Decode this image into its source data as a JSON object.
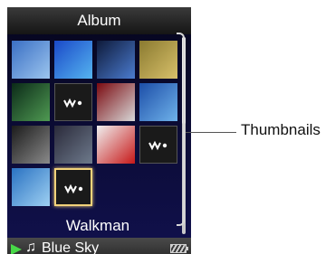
{
  "header": {
    "title": "Album"
  },
  "grid": {
    "thumbnails": [
      {
        "name": "album-art-snowman",
        "colors": [
          "#3a6fc4",
          "#9cc5ee"
        ]
      },
      {
        "name": "album-art-blue-burst",
        "colors": [
          "#1a49c8",
          "#55b4f0"
        ]
      },
      {
        "name": "album-art-microphone",
        "colors": [
          "#0e1a3a",
          "#4b7cd0"
        ]
      },
      {
        "name": "album-art-building",
        "colors": [
          "#8a7a30",
          "#d8c06a"
        ]
      },
      {
        "name": "album-art-green-plant",
        "colors": [
          "#0b2a18",
          "#4f9a52"
        ]
      },
      {
        "name": "album-art-walkman",
        "walkman": true
      },
      {
        "name": "album-art-guitar",
        "colors": [
          "#7a0a10",
          "#d8d8d8"
        ]
      },
      {
        "name": "album-art-blue-tiles",
        "colors": [
          "#1c4ea8",
          "#6fb2ea"
        ]
      },
      {
        "name": "album-art-dark-machine",
        "colors": [
          "#1b1b1b",
          "#8a8a8a"
        ]
      },
      {
        "name": "album-art-industrial",
        "colors": [
          "#2a2a3a",
          "#6e7a8c"
        ]
      },
      {
        "name": "album-art-red-car",
        "colors": [
          "#f0f0f0",
          "#c71818"
        ]
      },
      {
        "name": "album-art-walkman",
        "walkman": true
      },
      {
        "name": "album-art-palm-tree",
        "colors": [
          "#2a72c2",
          "#9ed0f2"
        ]
      },
      {
        "name": "album-art-walkman-selected",
        "walkman": true,
        "selected": true
      }
    ],
    "selected_caption": "Walkman"
  },
  "status": {
    "track": "Blue Sky"
  },
  "callout": {
    "label": "Thumbnails"
  }
}
